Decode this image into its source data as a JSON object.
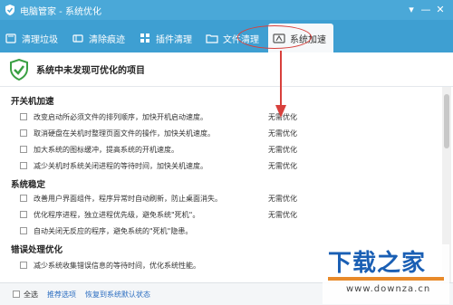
{
  "window": {
    "title": "电脑管家 - 系统优化",
    "controls": [
      "▾",
      "—",
      "✕"
    ]
  },
  "tabs": [
    {
      "label": "清理垃圾",
      "icon": "broom-icon",
      "active": false
    },
    {
      "label": "清除痕迹",
      "icon": "eraser-icon",
      "active": false
    },
    {
      "label": "插件清理",
      "icon": "puzzle-icon",
      "active": false
    },
    {
      "label": "文件清理",
      "icon": "folder-icon",
      "active": false
    },
    {
      "label": "系统加速",
      "icon": "rocket-icon",
      "active": true
    }
  ],
  "status": {
    "message": "系统中未发现可优化的项目"
  },
  "sections": [
    {
      "title": "开关机加速",
      "items": [
        {
          "label": "改变启动所必须文件的排列顺序，加快开机启动速度。",
          "state": "无需优化"
        },
        {
          "label": "取消硬盘在关机时整理页面文件的操作，加快关机速度。",
          "state": "无需优化"
        },
        {
          "label": "加大系统的图标缓冲，提高系统的开机速度。",
          "state": "无需优化"
        },
        {
          "label": "减少关机时系统关闭进程的等待时间，加快关机速度。",
          "state": "无需优化"
        }
      ]
    },
    {
      "title": "系统稳定",
      "items": [
        {
          "label": "改善用户界面组件，程序异常时自动刷新，防止桌面消失。",
          "state": "无需优化"
        },
        {
          "label": "优化程序进程，独立进程优先级，避免系统\"死机\"。",
          "state": "无需优化"
        },
        {
          "label": "自动关闭无反应的程序，避免系统的\"死机\"隐患。",
          "state": "无需优化"
        }
      ]
    },
    {
      "title": "错误处理优化",
      "items": [
        {
          "label": "减少系统收集错误信息的等待时间，优化系统性能。",
          "state": "无需优化"
        }
      ]
    }
  ],
  "footer": {
    "select_all": "全选",
    "recommended": "推荐选项",
    "restore": "恢复到系统默认状态"
  },
  "watermark": {
    "logo": "下载之家",
    "site": "www.downza.cn"
  },
  "colors": {
    "titlebar": "#4aa8d8",
    "tabbar": "#3e9fd2",
    "accent_red": "#d8403c",
    "link": "#2a6cc0"
  }
}
